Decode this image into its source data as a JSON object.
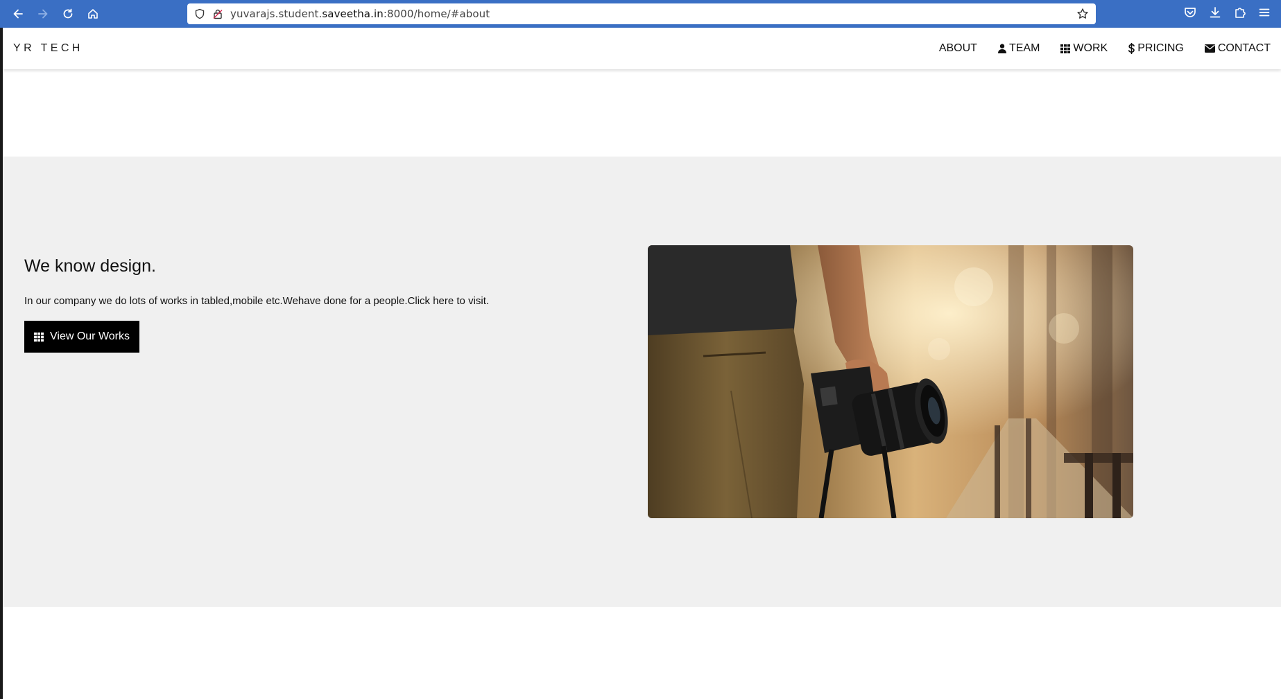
{
  "browser": {
    "url_prefix": "yuvarajs.student.",
    "url_domain": "saveetha.in",
    "url_suffix": ":8000/home/#about",
    "accent_color": "#3a6fc4"
  },
  "site": {
    "brand": "YR TECH",
    "nav": [
      {
        "label": "ABOUT",
        "icon": "none"
      },
      {
        "label": "TEAM",
        "icon": "user-icon"
      },
      {
        "label": "WORK",
        "icon": "grid-icon"
      },
      {
        "label": "PRICING",
        "icon": "dollar-icon"
      },
      {
        "label": "CONTACT",
        "icon": "envelope-icon"
      }
    ]
  },
  "about": {
    "title": "We know design.",
    "text": "In our company we do lots of works in tabled,mobile etc.Wehave done for a people.Click here to visit.",
    "button_label": "View Our Works",
    "button_icon": "grid-icon",
    "section_bg": "#f0f0f0",
    "image_subject": "photographer-holding-camera"
  }
}
